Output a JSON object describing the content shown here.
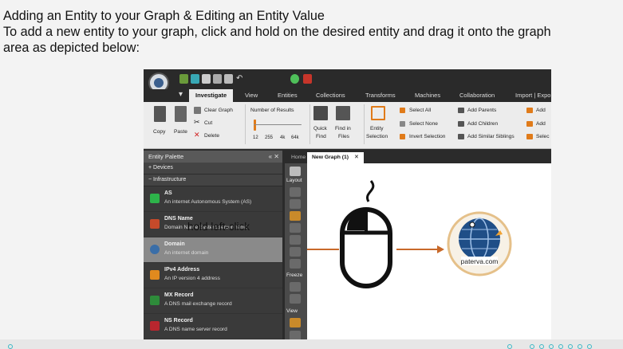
{
  "intro": {
    "title": "Adding an Entity to your Graph & Editing an Entity Value",
    "line1": "To add a new entity to your graph, click and hold on the desired entity and drag it onto the graph",
    "line2": "area as depicted below:"
  },
  "app": {
    "tabs": [
      "Investigate",
      "View",
      "Entities",
      "Collections",
      "Transforms",
      "Machines",
      "Collaboration",
      "Import | Expo"
    ],
    "active_tab": "Investigate",
    "ribbon": {
      "copy": "Copy",
      "paste": "Paste",
      "clear_graph": "Clear Graph",
      "cut": "Cut",
      "delete": "Delete",
      "number_of_results": "Number of Results",
      "slider_ticks": [
        "12",
        "255",
        "4k",
        "64k"
      ],
      "quick_find_1": "Quick",
      "quick_find_2": "Find",
      "find_in_1": "Find in",
      "find_in_2": "Files",
      "entity_sel_1": "Entity",
      "entity_sel_2": "Selection",
      "select_all": "Select All",
      "select_none": "Select None",
      "invert_selection": "Invert Selection",
      "add_parents": "Add Parents",
      "add_children": "Add Children",
      "add_similar_siblings": "Add Similar Siblings",
      "add_a": "Add",
      "add_b": "Add",
      "select_c": "Selec"
    },
    "palette": {
      "title": "Entity Palette",
      "sections": {
        "devices": "+ Devices",
        "infrastructure": "− Infrastructure"
      },
      "entities": [
        {
          "name": "AS",
          "desc": "An internet Autonomous System (AS)",
          "color": "#2db34a"
        },
        {
          "name": "DNS Name",
          "desc": "Domain Name System server name",
          "color": "#c64a2a"
        },
        {
          "name": "Domain",
          "desc": "An internet domain",
          "color": "#3a6ea8"
        },
        {
          "name": "IPv4 Address",
          "desc": "An IP version 4 address",
          "color": "#e08a1e"
        },
        {
          "name": "MX Record",
          "desc": "A DNS mail exchange record",
          "color": "#2e8b3a"
        },
        {
          "name": "NS Record",
          "desc": "A DNS name server record",
          "color": "#b8262e"
        }
      ]
    },
    "graph_tabs": {
      "home": "Home",
      "new_graph": "New Graph (1)"
    },
    "sidebar_labels": {
      "layout": "Layout",
      "freeze": "Freeze",
      "view": "View"
    },
    "drop_entity_label": "paterva.com"
  },
  "caption": "hold left-click",
  "colors": {
    "arrow": "#c8692a",
    "accent": "#f07f1a",
    "globe": "#1f4e87"
  }
}
